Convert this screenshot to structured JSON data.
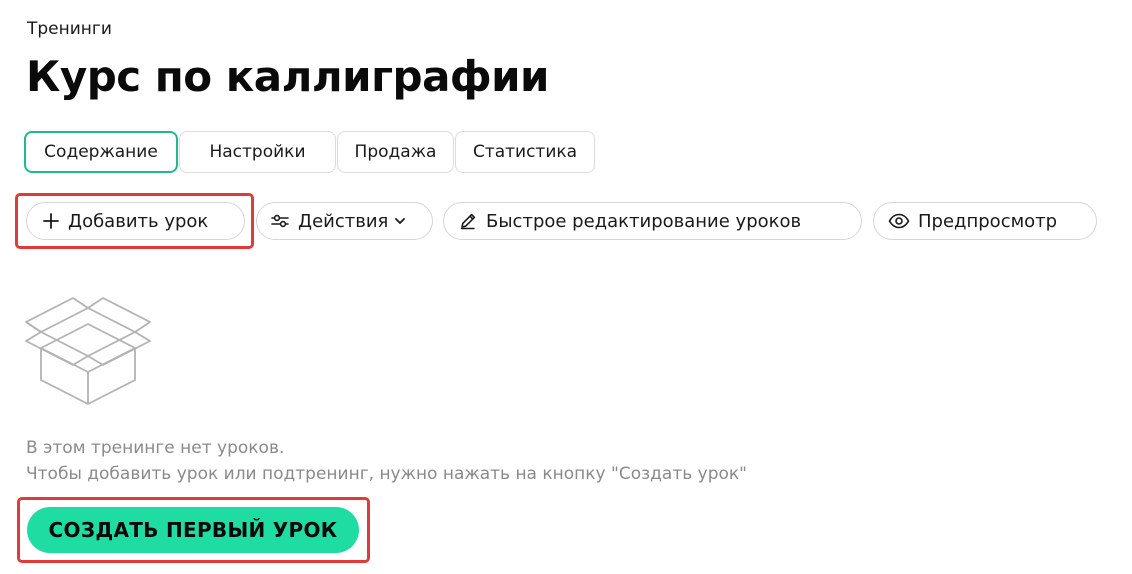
{
  "breadcrumb": "Тренинги",
  "page_title": "Курс по каллиграфии",
  "tabs": [
    {
      "label": "Содержание",
      "active": true
    },
    {
      "label": "Настройки",
      "active": false
    },
    {
      "label": "Продажа",
      "active": false
    },
    {
      "label": "Статистика",
      "active": false
    }
  ],
  "toolbar": {
    "add_lesson": {
      "label": "Добавить урок",
      "icon": "plus-icon"
    },
    "actions": {
      "label": "Действия",
      "icon": "sliders-icon",
      "dropdown_icon": "chevron-down-icon"
    },
    "quick_edit": {
      "label": "Быстрое редактирование уроков",
      "icon": "pencil-icon"
    },
    "preview": {
      "label": "Предпросмотр",
      "icon": "eye-icon"
    }
  },
  "empty_state": {
    "icon": "empty-box-icon",
    "line1": "В этом тренинге нет уроков.",
    "line2": "Чтобы добавить урок или подтренинг, нужно нажать на кнопку \"Создать урок\"",
    "cta_label": "СОЗДАТЬ ПЕРВЫЙ УРОК"
  },
  "colors": {
    "accent": "#1fdca3",
    "active_tab_border": "#1fb98c",
    "highlight": "#df3b3b",
    "muted_text": "#8a8a8a"
  }
}
